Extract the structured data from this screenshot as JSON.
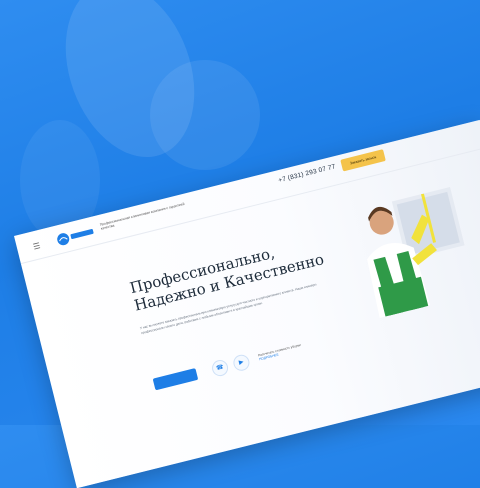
{
  "header": {
    "tagline": "Профессиональная клининговая компания с гарантией качества",
    "phone": "+7 (831) 293 07 77",
    "callback_label": "Заказать звонок"
  },
  "hero": {
    "title": "Профессионально, Надежно и Качественно",
    "description": "У нас вы можете заказать профессиональную клининговую услугу для частного и корпоративного клиента. Наши клинеры профессионалы своего дела, работаем с любыми объектами и в кратчайшие сроки."
  },
  "footer_note": {
    "text": "Рассчитать стоимость уборки",
    "link": "ПОДРОБНЕЕ"
  },
  "colors": {
    "accent": "#1e7ee6",
    "button": "#f4c34b"
  },
  "icons": {
    "menu": "hamburger-icon",
    "phone": "phone-icon",
    "play": "play-icon"
  }
}
